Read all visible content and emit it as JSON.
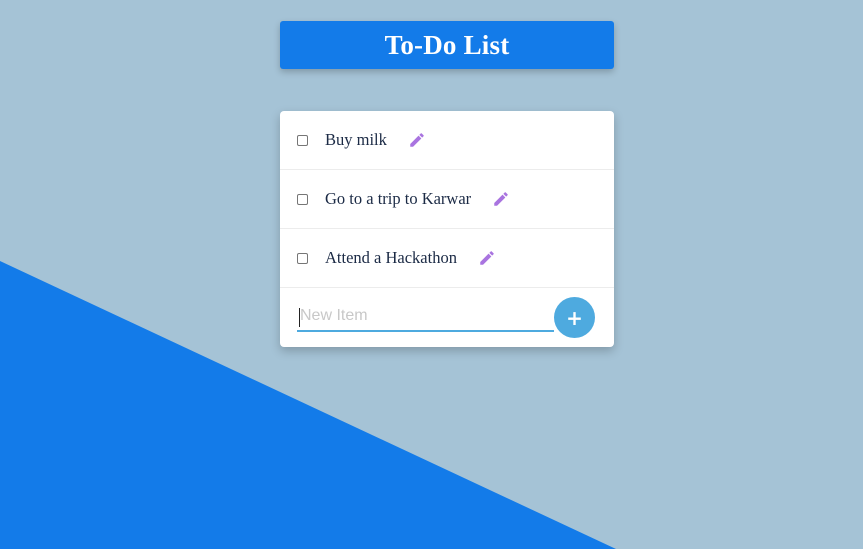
{
  "app": {
    "title": "To-Do List"
  },
  "todo": {
    "items": [
      {
        "label": "Buy milk",
        "checked": false,
        "edit_icon": "pencil-icon"
      },
      {
        "label": "Go to a trip to Karwar",
        "checked": false,
        "edit_icon": "pencil-icon"
      },
      {
        "label": "Attend a Hackathon",
        "checked": false,
        "edit_icon": "pencil-icon"
      }
    ],
    "new_item": {
      "placeholder": "New Item",
      "value": ""
    },
    "add_button": {
      "label": "+",
      "icon": "plus-icon"
    }
  },
  "colors": {
    "background": "#a5c3d6",
    "accent_blue": "#137be9",
    "add_button": "#4eaadf",
    "edit_icon": "#a974e0"
  }
}
